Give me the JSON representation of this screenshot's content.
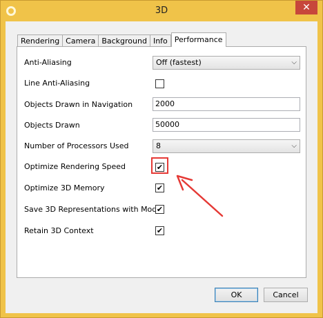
{
  "window": {
    "title": "3D",
    "close_glyph": "✕",
    "accent": "#f0c349",
    "close_color": "#c7463b"
  },
  "tabs": [
    {
      "label": "Rendering",
      "active": false
    },
    {
      "label": "Camera",
      "active": false
    },
    {
      "label": "Background",
      "active": false
    },
    {
      "label": "Info",
      "active": false
    },
    {
      "label": "Performance",
      "active": true
    }
  ],
  "settings": {
    "anti_aliasing": {
      "label": "Anti-Aliasing",
      "value": "Off (fastest)"
    },
    "line_anti_aliasing": {
      "label": "Line Anti-Aliasing",
      "checked": false
    },
    "objects_nav": {
      "label": "Objects Drawn in Navigation",
      "value": "2000"
    },
    "objects_drawn": {
      "label": "Objects Drawn",
      "value": "50000"
    },
    "processors": {
      "label": "Number of Processors Used",
      "value": "8"
    },
    "optimize_speed": {
      "label": "Optimize Rendering Speed",
      "checked": true,
      "mark": "✔"
    },
    "optimize_memory": {
      "label": "Optimize 3D Memory",
      "checked": true,
      "mark": "✔"
    },
    "save_reps": {
      "label": "Save 3D Representations with Model",
      "checked": true,
      "mark": "✔"
    },
    "retain_context": {
      "label": "Retain 3D Context",
      "checked": true,
      "mark": "✔"
    }
  },
  "buttons": {
    "ok": "OK",
    "cancel": "Cancel"
  },
  "annotation": {
    "color": "#e53935"
  }
}
